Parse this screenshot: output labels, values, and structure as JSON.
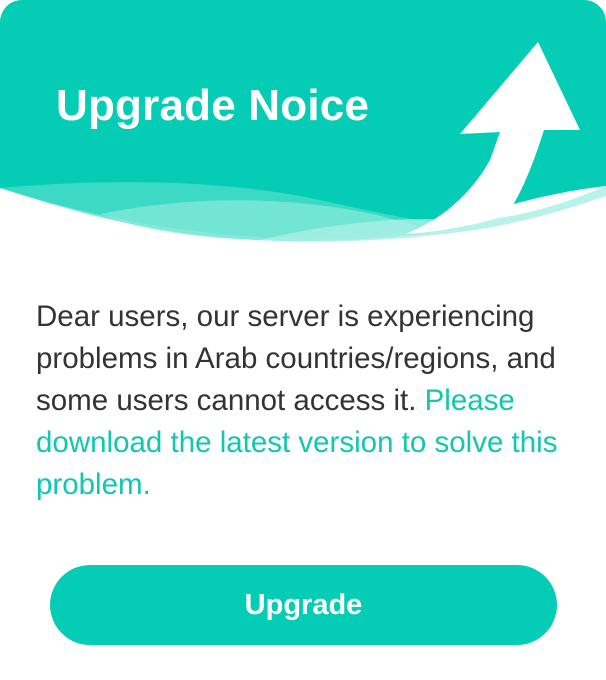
{
  "dialog": {
    "title": "Upgrade Noice",
    "message_text": "Dear users, our server is experiencing problems in Arab countries/regions, and some users cannot access it.",
    "message_highlight": "Please download the latest version to solve this problem.",
    "upgrade_button_label": "Upgrade"
  },
  "colors": {
    "brand_teal": "#05cdb5",
    "highlight_text": "#12c6b0",
    "body_text": "#333333",
    "background": "#ffffff"
  },
  "icons": {
    "header_graphic": "upward-arrow-icon"
  }
}
